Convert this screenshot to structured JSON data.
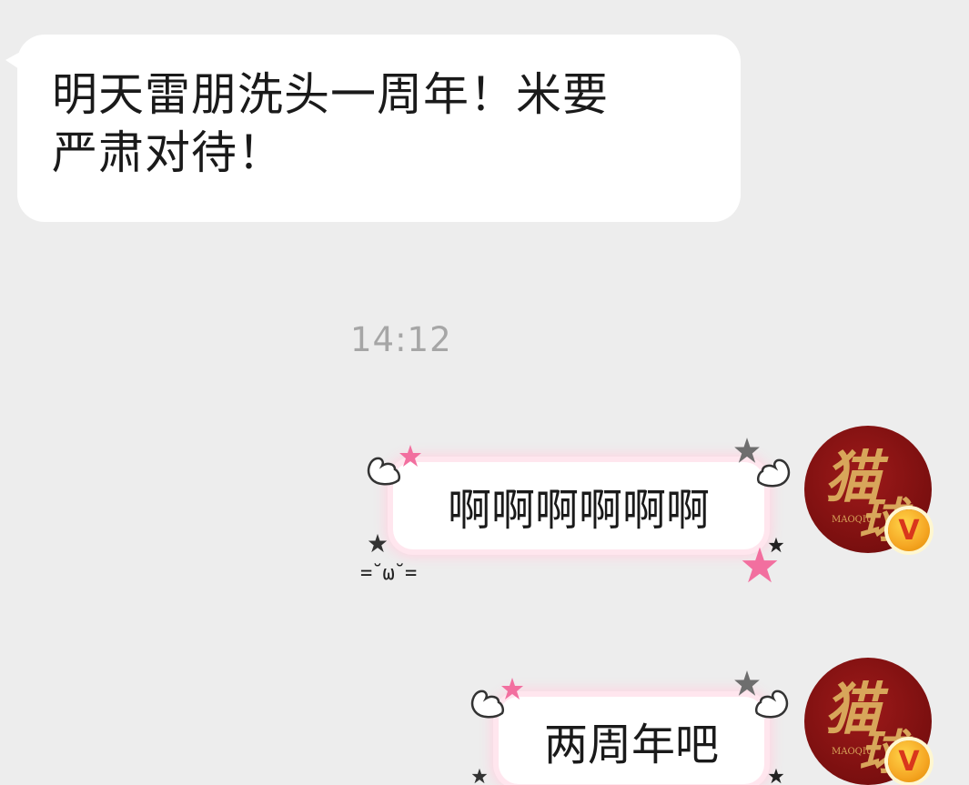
{
  "incoming": {
    "line1": "明天雷朋洗头一周年！米要",
    "line2": "严肃对待！"
  },
  "timestamp": "14:12",
  "outgoing": [
    {
      "text": "啊啊啊啊啊啊"
    },
    {
      "text": "两周年吧"
    }
  ],
  "avatar": {
    "glyph1": "猫",
    "glyph2": "球",
    "brand": "MAOQIU",
    "badge": "V"
  },
  "sticker_face": "=˘ω˘="
}
